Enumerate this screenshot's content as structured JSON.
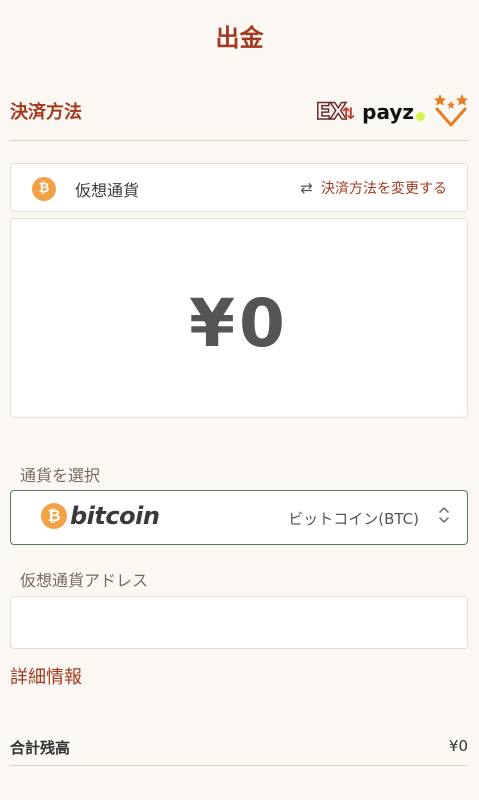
{
  "header": {
    "title": "出金"
  },
  "payment_method": {
    "label": "決済方法",
    "logos": [
      {
        "name": "ex-logo",
        "text": "EX"
      },
      {
        "name": "payz-logo",
        "text": "payz"
      },
      {
        "name": "star-logo",
        "icon": "stars-check-icon"
      }
    ]
  },
  "crypto_card": {
    "coin_icon": "bitcoin-icon",
    "coin_glyph": "₿",
    "label": "仮想通貨",
    "change_icon": "swap-arrows-icon",
    "change_label": "決済方法を変更する"
  },
  "amount": {
    "display": "¥0"
  },
  "currency_select": {
    "label": "通貨を選択",
    "brand_glyph": "₿",
    "brand_word": "bitcoin",
    "selected": "ビットコイン(BTC)"
  },
  "address": {
    "label": "仮想通貨アドレス",
    "value": "",
    "placeholder": ""
  },
  "details": {
    "label": "詳細情報"
  },
  "balance": {
    "label": "合計残高",
    "value": "¥0"
  },
  "colors": {
    "accent": "#a33a1f",
    "background": "#fbf7f3",
    "bitcoin": "#f2a246",
    "select_border": "#5b7a66"
  }
}
